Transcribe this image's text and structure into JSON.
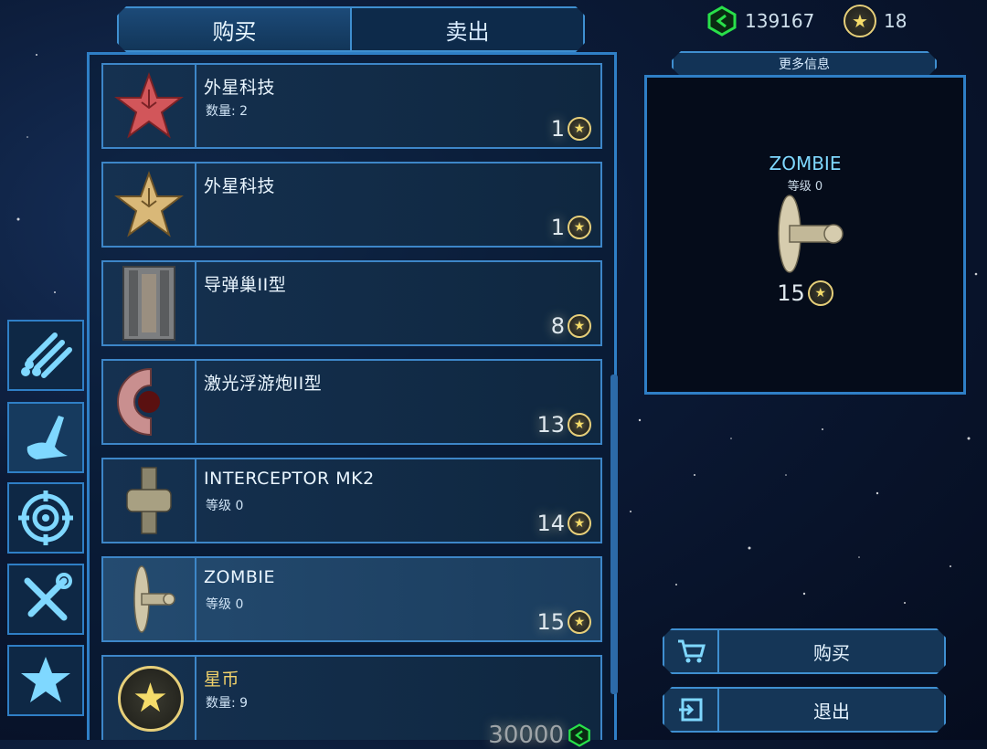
{
  "tabs": {
    "buy": "购买",
    "sell": "卖出"
  },
  "hud": {
    "credits": "139167",
    "stars": "18"
  },
  "more_info": "更多信息",
  "items": [
    {
      "name": "外星科技",
      "sub": "数量: 2",
      "price": "1",
      "currency": "star-coin-icon",
      "icon": "red-circuit-star-icon"
    },
    {
      "name": "外星科技",
      "sub": "",
      "price": "1",
      "currency": "star-coin-icon",
      "icon": "gold-circuit-star-icon"
    },
    {
      "name": "导弹巢II型",
      "sub": "",
      "price": "8",
      "currency": "star-coin-icon",
      "icon": "missile-nest-icon"
    },
    {
      "name": "激光浮游炮II型",
      "sub": "",
      "price": "13",
      "currency": "star-coin-icon",
      "icon": "laser-drone-icon"
    },
    {
      "name": "INTERCEPTOR MK2",
      "sub": "等级 0",
      "price": "14",
      "currency": "star-coin-icon",
      "icon": "interceptor-ship-icon"
    },
    {
      "name": "ZOMBIE",
      "sub": "等级 0",
      "price": "15",
      "currency": "star-coin-icon",
      "icon": "zombie-ship-icon",
      "selected": true
    },
    {
      "name": "星币",
      "sub": "数量: 9",
      "price": "30000",
      "currency": "credit-icon",
      "icon": "star-coin-big-icon"
    }
  ],
  "preview": {
    "name": "ZOMBIE",
    "level": "等级 0",
    "price": "15"
  },
  "buttons": {
    "buy": "购买",
    "exit": "退出"
  },
  "colors": {
    "accent": "#3f8fd0",
    "credit_green": "#29e04a",
    "coin_gold": "#e6cf7a",
    "name_cyan": "#7fd8ff"
  }
}
